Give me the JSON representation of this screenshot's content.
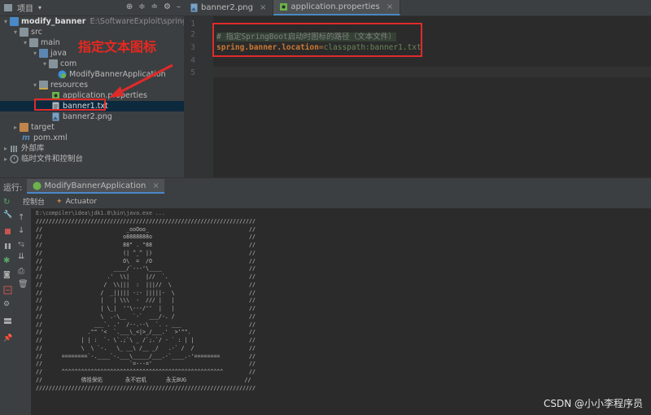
{
  "project": {
    "panel_label": "项目",
    "tree": [
      {
        "label": "modify_banner",
        "path_hint": "E:\\SoftwareExploit\\springboot2...",
        "level": 0,
        "expanded": true,
        "icon": "module-icon"
      },
      {
        "label": "src",
        "level": 1,
        "expanded": true,
        "icon": "folder-icon"
      },
      {
        "label": "main",
        "level": 2,
        "expanded": true,
        "icon": "folder-icon"
      },
      {
        "label": "java",
        "level": 3,
        "expanded": true,
        "icon": "source-folder-icon"
      },
      {
        "label": "com",
        "level": 4,
        "expanded": true,
        "icon": "package-icon"
      },
      {
        "label": "ModifyBannerApplication",
        "level": 5,
        "icon": "spring-class-icon"
      },
      {
        "label": "resources",
        "level": 3,
        "expanded": true,
        "icon": "resources-folder-icon"
      },
      {
        "label": "application.properties",
        "level": 4,
        "icon": "properties-file-icon"
      },
      {
        "label": "banner1.txt",
        "level": 4,
        "selected": true,
        "icon": "text-file-icon"
      },
      {
        "label": "banner2.png",
        "level": 4,
        "icon": "image-file-icon"
      },
      {
        "label": "target",
        "level": 1,
        "expanded": false,
        "icon": "excluded-folder-icon"
      },
      {
        "label": "pom.xml",
        "level": 1,
        "icon": "maven-icon"
      },
      {
        "label": "外部库",
        "level": 0,
        "expanded": false,
        "icon": "library-icon"
      },
      {
        "label": "临时文件和控制台",
        "level": 0,
        "expanded": false,
        "icon": "scratch-icon"
      }
    ]
  },
  "editor": {
    "tabs": [
      {
        "label": "banner2.png",
        "active": false
      },
      {
        "label": "application.properties",
        "active": true
      }
    ],
    "line_numbers": [
      "1",
      "2",
      "3",
      "4",
      "5"
    ],
    "comment": "# 指定SpringBoot启动时图标的路径（文本文件）",
    "key": "spring.banner.location",
    "eq": "=",
    "value": "classpath:banner1.txt"
  },
  "annotation": {
    "label": "指定文本图标",
    "color": "#e8281f"
  },
  "run": {
    "label": "运行:",
    "config": "ModifyBannerApplication",
    "subtabs": [
      "控制台",
      "Actuator"
    ],
    "console_lines": [
      "E:\\compiler\\idea\\jdk1.8\\bin\\java.exe ...",
      "////////////////////////////////////////////////////////////////////",
      "//                          _ooOoo_                               //",
      "//                         o8888888o                              //",
      "//                         88\" . \"88                              //",
      "//                         (| ^_^ |)                              //",
      "//                         O\\  =  /O                              //",
      "//                      ____/`---'\\____                           //",
      "//                    .'  \\\\|     |//  `.                         //",
      "//                   /  \\\\|||  :  |||//  \\                        //",
      "//                  /  _||||| -:- |||||-  \\                       //",
      "//                  |   | \\\\\\  -  /// |   |                       //",
      "//                  | \\_|  ''\\---/''  |   |                       //",
      "//                  \\  .-\\__  `-`  ___/-. /                       //",
      "//                ___`. .'  /--.--\\  `. . ___                     //",
      "//              .\"\" '<  `.___\\_<|>_/___.'  >'\"\".                  //",
      "//            | | :  `- \\`.;`\\ _ /`;.`/ - ` : | |                 //",
      "//            \\  \\ `-.   \\_ __\\ /__ _/   .-` /  /                 //",
      "//      ========`-.____`-.___\\_____/___.-`____.-'========         //",
      "//                           `=---='                              //",
      "//      ^^^^^^^^^^^^^^^^^^^^^^^^^^^^^^^^^^^^^^^^^^^^^^^^^^        //",
      "//            佛祖保佑       永不宕机      永无BUG                  //",
      "////////////////////////////////////////////////////////////////////"
    ]
  },
  "watermark": "CSDN @小小李程序员",
  "colors": {
    "comment": "#808080",
    "key": "#cc7832",
    "value": "#6a8759",
    "highlight": "#344134"
  }
}
